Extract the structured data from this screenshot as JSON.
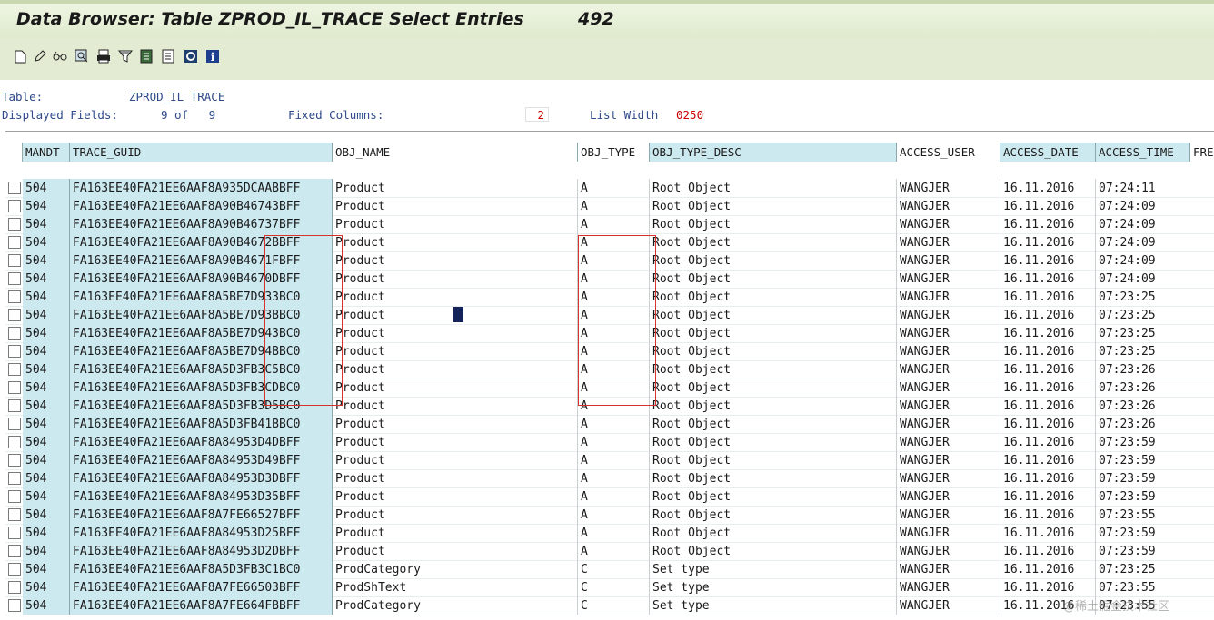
{
  "title": {
    "text": "Data Browser: Table ZPROD_IL_TRACE Select Entries",
    "count": "492"
  },
  "toolbar": {
    "icons": [
      "new-icon",
      "edit-icon",
      "glasses-icon",
      "find-icon",
      "print-icon",
      "filter-icon",
      "export-icon",
      "layout-icon",
      "refresh-icon",
      "info-icon"
    ]
  },
  "info": {
    "table_label": "Table:",
    "table_value": "ZPROD_IL_TRACE",
    "fields_label": "Displayed Fields:",
    "fields_value": "9 of   9",
    "fixed_label": "Fixed Columns:",
    "fixed_value": "2",
    "width_label": "List Width",
    "width_value": "0250"
  },
  "columns": [
    "MANDT",
    "TRACE_GUID",
    "OBJ_NAME",
    "OBJ_TYPE",
    "OBJ_TYPE_DESC",
    "ACCESS_USER",
    "ACCESS_DATE",
    "ACCESS_TIME",
    "FRE"
  ],
  "rows": [
    [
      "504",
      "FA163EE40FA21EE6AAF8A935DCAABBFF",
      "Product",
      "A",
      "Root Object",
      "WANGJER",
      "16.11.2016",
      "07:24:11"
    ],
    [
      "504",
      "FA163EE40FA21EE6AAF8A90B46743BFF",
      "Product",
      "A",
      "Root Object",
      "WANGJER",
      "16.11.2016",
      "07:24:09"
    ],
    [
      "504",
      "FA163EE40FA21EE6AAF8A90B46737BFF",
      "Product",
      "A",
      "Root Object",
      "WANGJER",
      "16.11.2016",
      "07:24:09"
    ],
    [
      "504",
      "FA163EE40FA21EE6AAF8A90B4672BBFF",
      "Product",
      "A",
      "Root Object",
      "WANGJER",
      "16.11.2016",
      "07:24:09"
    ],
    [
      "504",
      "FA163EE40FA21EE6AAF8A90B4671FBFF",
      "Product",
      "A",
      "Root Object",
      "WANGJER",
      "16.11.2016",
      "07:24:09"
    ],
    [
      "504",
      "FA163EE40FA21EE6AAF8A90B4670DBFF",
      "Product",
      "A",
      "Root Object",
      "WANGJER",
      "16.11.2016",
      "07:24:09"
    ],
    [
      "504",
      "FA163EE40FA21EE6AAF8A5BE7D933BC0",
      "Product",
      "A",
      "Root Object",
      "WANGJER",
      "16.11.2016",
      "07:23:25"
    ],
    [
      "504",
      "FA163EE40FA21EE6AAF8A5BE7D93BBC0",
      "Product",
      "A",
      "Root Object",
      "WANGJER",
      "16.11.2016",
      "07:23:25"
    ],
    [
      "504",
      "FA163EE40FA21EE6AAF8A5BE7D943BC0",
      "Product",
      "A",
      "Root Object",
      "WANGJER",
      "16.11.2016",
      "07:23:25"
    ],
    [
      "504",
      "FA163EE40FA21EE6AAF8A5BE7D94BBC0",
      "Product",
      "A",
      "Root Object",
      "WANGJER",
      "16.11.2016",
      "07:23:25"
    ],
    [
      "504",
      "FA163EE40FA21EE6AAF8A5D3FB3C5BC0",
      "Product",
      "A",
      "Root Object",
      "WANGJER",
      "16.11.2016",
      "07:23:26"
    ],
    [
      "504",
      "FA163EE40FA21EE6AAF8A5D3FB3CDBC0",
      "Product",
      "A",
      "Root Object",
      "WANGJER",
      "16.11.2016",
      "07:23:26"
    ],
    [
      "504",
      "FA163EE40FA21EE6AAF8A5D3FB3D5BC0",
      "Product",
      "A",
      "Root Object",
      "WANGJER",
      "16.11.2016",
      "07:23:26"
    ],
    [
      "504",
      "FA163EE40FA21EE6AAF8A5D3FB41BBC0",
      "Product",
      "A",
      "Root Object",
      "WANGJER",
      "16.11.2016",
      "07:23:26"
    ],
    [
      "504",
      "FA163EE40FA21EE6AAF8A84953D4DBFF",
      "Product",
      "A",
      "Root Object",
      "WANGJER",
      "16.11.2016",
      "07:23:59"
    ],
    [
      "504",
      "FA163EE40FA21EE6AAF8A84953D49BFF",
      "Product",
      "A",
      "Root Object",
      "WANGJER",
      "16.11.2016",
      "07:23:59"
    ],
    [
      "504",
      "FA163EE40FA21EE6AAF8A84953D3DBFF",
      "Product",
      "A",
      "Root Object",
      "WANGJER",
      "16.11.2016",
      "07:23:59"
    ],
    [
      "504",
      "FA163EE40FA21EE6AAF8A84953D35BFF",
      "Product",
      "A",
      "Root Object",
      "WANGJER",
      "16.11.2016",
      "07:23:59"
    ],
    [
      "504",
      "FA163EE40FA21EE6AAF8A7FE66527BFF",
      "Product",
      "A",
      "Root Object",
      "WANGJER",
      "16.11.2016",
      "07:23:55"
    ],
    [
      "504",
      "FA163EE40FA21EE6AAF8A84953D25BFF",
      "Product",
      "A",
      "Root Object",
      "WANGJER",
      "16.11.2016",
      "07:23:59"
    ],
    [
      "504",
      "FA163EE40FA21EE6AAF8A84953D2DBFF",
      "Product",
      "A",
      "Root Object",
      "WANGJER",
      "16.11.2016",
      "07:23:59"
    ],
    [
      "504",
      "FA163EE40FA21EE6AAF8A5D3FB3C1BC0",
      "ProdCategory",
      "C",
      "Set type",
      "WANGJER",
      "16.11.2016",
      "07:23:25"
    ],
    [
      "504",
      "FA163EE40FA21EE6AAF8A7FE66503BFF",
      "ProdShText",
      "C",
      "Set type",
      "WANGJER",
      "16.11.2016",
      "07:23:55"
    ],
    [
      "504",
      "FA163EE40FA21EE6AAF8A7FE664FBBFF",
      "ProdCategory",
      "C",
      "Set type",
      "WANGJER",
      "16.11.2016",
      "07:23:55"
    ]
  ],
  "watermark": "@稀土掘金技术社区",
  "colors": {
    "key_bg": "#cde9f0",
    "title_bg": "#e3ecd2",
    "highlight_border": "#d8332a",
    "info_text": "#2f4a8a"
  }
}
